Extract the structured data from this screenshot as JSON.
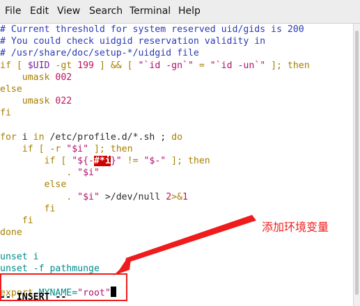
{
  "menu": {
    "items": [
      "File",
      "Edit",
      "View",
      "Search",
      "Terminal",
      "Help"
    ]
  },
  "code": {
    "line1": "# Current threshold for system reserved uid/gids is 200",
    "line2": "# You could check uidgid reservation validity in",
    "line3": "# /usr/share/doc/setup-*/uidgid file",
    "line4": {
      "a": "if [ ",
      "b": "$UID",
      "c": " -gt ",
      "d": "199",
      "e": " ] && [ ",
      "f": "\"`id -gn`\"",
      "g": " = ",
      "h": "\"`id -un`\"",
      "i": " ]; then"
    },
    "line5": {
      "a": "    umask ",
      "b": "002"
    },
    "line6": "else",
    "line7": {
      "a": "    umask ",
      "b": "022"
    },
    "line8": "fi",
    "line10": {
      "a": "for",
      "b": " i ",
      "c": "in",
      "d": " /etc/profile.d/*.sh ; ",
      "e": "do"
    },
    "line11": {
      "a": "    if [ -r ",
      "b": "\"$i\"",
      "c": " ]; then"
    },
    "line12": {
      "a": "        if [ ",
      "b": "\"${-",
      "c": "#*i",
      "d": "}\"",
      "e": " != ",
      "f": "\"$-\"",
      "g": " ]; then"
    },
    "line13": {
      "a": "            . ",
      "b": "\"$i\""
    },
    "line14": "        else",
    "line15": {
      "a": "            . ",
      "b": "\"$i\"",
      "c": " >/dev/null ",
      "d": "2",
      "e": ">&",
      "f": "1"
    },
    "line16": "        fi",
    "line17": "    fi",
    "line18": "done",
    "line20": {
      "a": "unset",
      "b": " i"
    },
    "line21": {
      "a": "unset -f",
      "b": " pathmunge"
    },
    "line23": {
      "a": "export",
      "b": " MYNAME=",
      "c": "\"root\""
    }
  },
  "status": {
    "mode": "-- INSERT --"
  },
  "annotation": {
    "text": "添加环境变量",
    "color": "#ee1c1c"
  }
}
